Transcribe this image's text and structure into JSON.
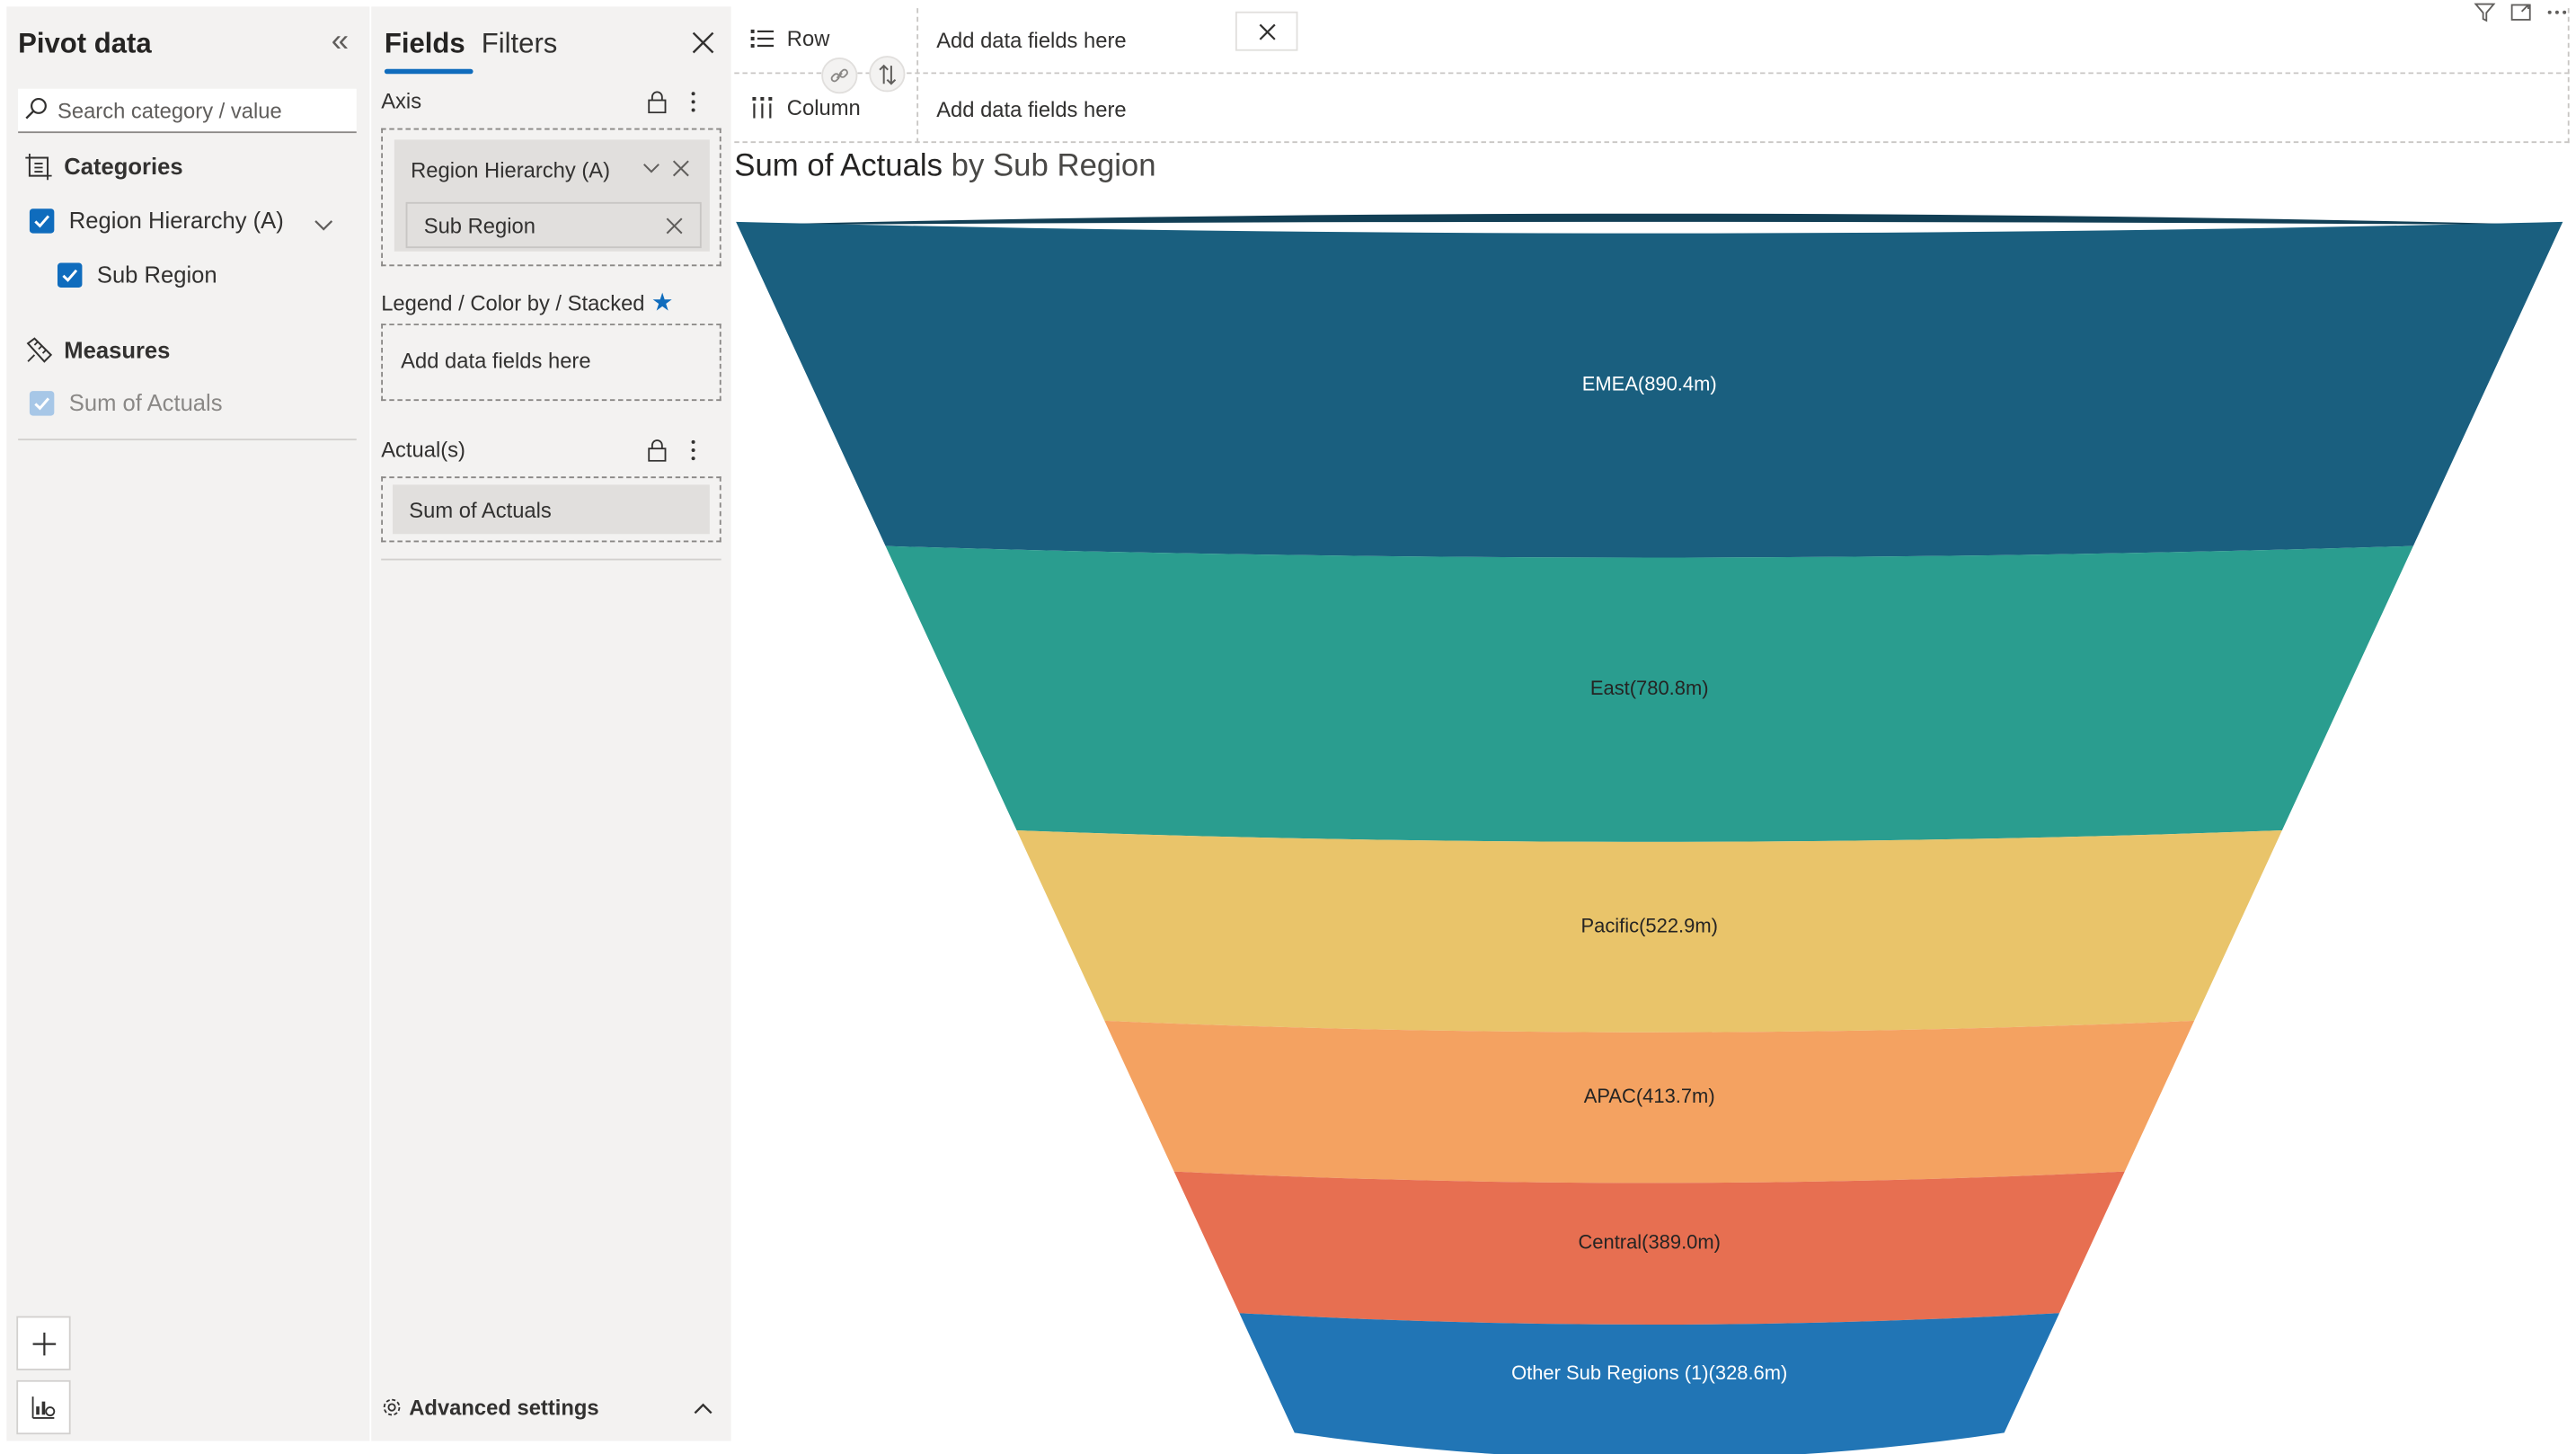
{
  "pivot": {
    "title": "Pivot data",
    "search_placeholder": "Search category / value",
    "categories_label": "Categories",
    "category_items": [
      "Region Hierarchy (A)",
      "Sub Region"
    ],
    "measures_label": "Measures",
    "measure_items": [
      "Sum of Actuals"
    ]
  },
  "fields": {
    "tab_fields": "Fields",
    "tab_filters": "Filters",
    "axis_label": "Axis",
    "axis_pills": [
      "Region Hierarchy (A)",
      "Sub Region"
    ],
    "legend_label": "Legend / Color by / Stacked",
    "legend_placeholder": "Add data fields here",
    "actuals_label": "Actual(s)",
    "actuals_pill": "Sum of Actuals",
    "advanced_settings": "Advanced settings"
  },
  "wells": {
    "row_label": "Row",
    "column_label": "Column",
    "row_placeholder": "Add data fields here",
    "column_placeholder": "Add data fields here"
  },
  "chart_title": {
    "measure": "Sum of Actuals",
    "rest": "by Sub Region"
  },
  "icons": [
    "collapse-double-chevron-icon",
    "search-icon",
    "categories-icon",
    "measures-icon",
    "checkbox-icon",
    "chevron-down-icon",
    "close-icon",
    "lock-icon",
    "more-vertical-icon",
    "star-icon",
    "gear-icon",
    "chevron-up-icon",
    "rows-icon",
    "columns-icon",
    "link-icon",
    "swap-icon",
    "filter-icon",
    "focus-mode-icon",
    "more-horizontal-icon",
    "add-icon",
    "chart-settings-icon"
  ],
  "colors": {
    "accent": "#0f6cbd",
    "panel_bg": "#f3f2f1"
  },
  "chart_data": {
    "type": "funnel",
    "title": "Sum of Actuals by Sub Region",
    "categories": [
      "EMEA",
      "East",
      "Pacific",
      "APAC",
      "Central",
      "Other Sub Regions (1)"
    ],
    "values": [
      890.4,
      780.8,
      522.9,
      413.7,
      389.0,
      328.6
    ],
    "labels": [
      "EMEA(890.4m)",
      "East(780.8m)",
      "Pacific(522.9m)",
      "APAC(413.7m)",
      "Central(389.0m)",
      "Other Sub Regions (1)(328.6m)"
    ],
    "unit": "m",
    "colors": [
      "#1a5f7f",
      "#2a9d8f",
      "#e9c46a",
      "#f4a261",
      "#e76f51",
      "#2175b5"
    ],
    "label_colors": [
      "#ffffff",
      "#252423",
      "#252423",
      "#252423",
      "#252423",
      "#ffffff"
    ]
  }
}
